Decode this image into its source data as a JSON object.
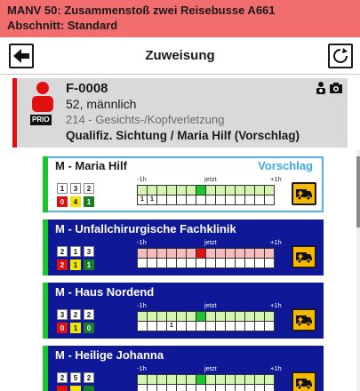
{
  "incident": {
    "title": "MANV 50: Zusammenstoß zwei Reisebusse A661",
    "section": "Abschnitt: Standard"
  },
  "toolbar": {
    "title": "Zuweisung",
    "back_icon": "arrow-left-icon",
    "refresh_icon": "refresh-icon"
  },
  "patient": {
    "id": "F-0008",
    "age_sex": "52, männlich",
    "prio_badge": "PRIO",
    "diagnosis": "214 - Gesichts-/Kopfverletzung",
    "qualification": "Qualifiz. Sichtung / Maria Hilf (Vorschlag)",
    "triage_color": "#e01010"
  },
  "timeline_labels": {
    "minus": "-1h",
    "now": "jetzt",
    "plus": "+1h"
  },
  "hospitals": [
    {
      "name": "M - Maria Hilf",
      "tag": "Vorschlag",
      "capacity_top": [
        "1",
        "3",
        "2"
      ],
      "capacity_bottom": [
        "0",
        "4",
        "1"
      ],
      "grid_color": "green",
      "now_color": "now-g",
      "bottom_row": [
        "1",
        "1",
        "",
        "",
        "",
        "",
        "",
        "",
        "",
        "",
        "",
        "",
        "",
        ""
      ]
    },
    {
      "name": "M - Unfallchirurgische Fachklinik",
      "tag": "",
      "capacity_top": [
        "2",
        "1",
        "3"
      ],
      "capacity_bottom": [
        "2",
        "1",
        "1"
      ],
      "grid_color": "pink",
      "now_color": "now-r",
      "bottom_row": [
        "",
        "",
        "",
        "",
        "",
        "",
        "",
        "",
        "",
        "",
        "",
        "",
        "",
        ""
      ]
    },
    {
      "name": "M - Haus Nordend",
      "tag": "",
      "capacity_top": [
        "3",
        "2",
        "2"
      ],
      "capacity_bottom": [
        "0",
        "1",
        "0"
      ],
      "grid_color": "green",
      "now_color": "now-g",
      "bottom_row": [
        "",
        "",
        "",
        "1",
        "",
        "",
        "",
        "",
        "",
        "",
        "",
        "",
        "",
        ""
      ]
    },
    {
      "name": "M - Heilige Johanna",
      "tag": "",
      "capacity_top": [
        "2",
        "5",
        "2"
      ],
      "capacity_bottom": [
        "",
        "",
        ""
      ],
      "grid_color": "green",
      "now_color": "now-g",
      "bottom_row": [
        "",
        "",
        "",
        "",
        "",
        "",
        "",
        "",
        "",
        "",
        "",
        "",
        "",
        ""
      ]
    }
  ]
}
